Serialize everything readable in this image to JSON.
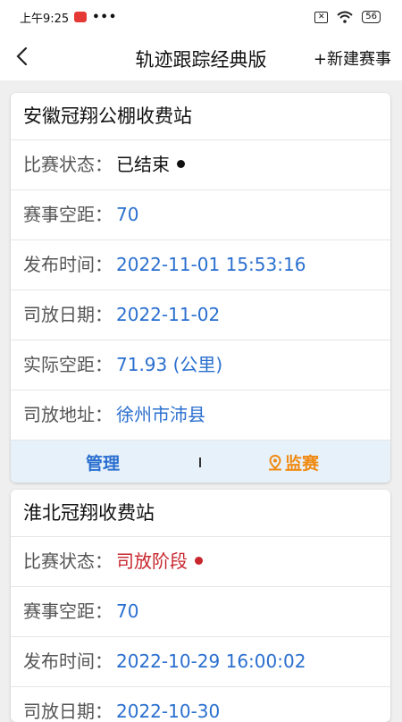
{
  "status_bar": {
    "time": "上午9:25",
    "dots": "•••",
    "x_icon_text": "✕",
    "battery": "56"
  },
  "header": {
    "title": "轨迹跟踪经典版",
    "new_button": "+新建赛事"
  },
  "cards": [
    {
      "name": "安徽冠翔公棚收费站",
      "rows": [
        {
          "label": "比赛状态：",
          "value": "已结束"
        },
        {
          "label": "赛事空距：",
          "value": "70"
        },
        {
          "label": "发布时间：",
          "value": "2022-11-01 15:53:16"
        },
        {
          "label": "司放日期：",
          "value": "2022-11-02"
        },
        {
          "label": "实际空距：",
          "value": "71.93 (公里)"
        },
        {
          "label": "司放地址：",
          "value": "徐州市沛县"
        }
      ],
      "status_color": "#111111",
      "manage": "管理",
      "monitor": "监赛"
    },
    {
      "name": "淮北冠翔收费站",
      "rows": [
        {
          "label": "比赛状态：",
          "value": "司放阶段"
        },
        {
          "label": "赛事空距：",
          "value": "70"
        },
        {
          "label": "发布时间：",
          "value": "2022-10-29 16:00:02"
        },
        {
          "label": "司放日期：",
          "value": "2022-10-30"
        }
      ],
      "status_color": "#c8262d"
    }
  ],
  "colors": {
    "accent_blue": "#2a6fcf",
    "accent_orange": "#f08a12"
  }
}
